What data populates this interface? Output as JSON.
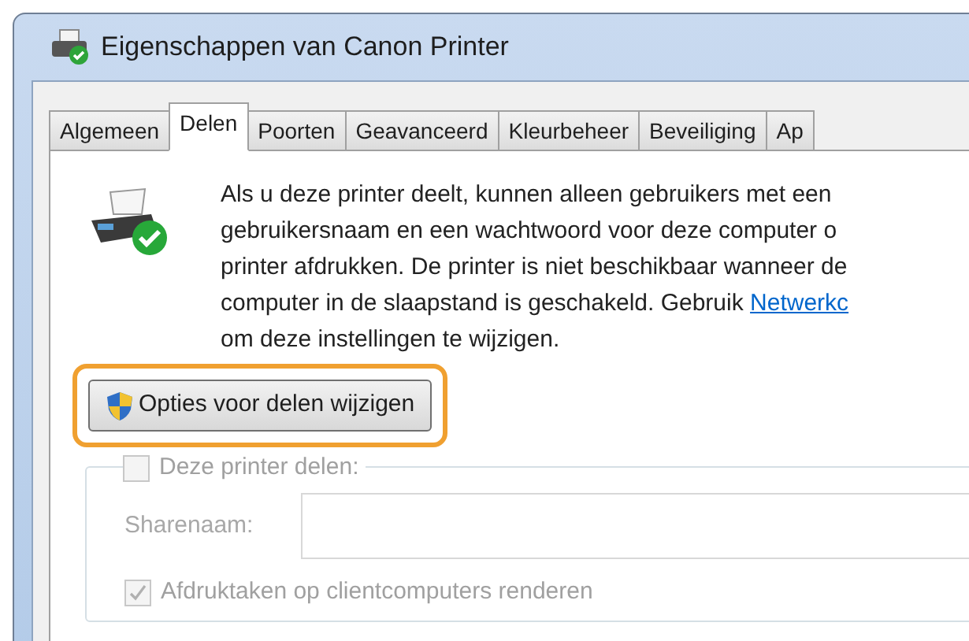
{
  "window": {
    "title": "Eigenschappen van Canon Printer"
  },
  "tabs": [
    {
      "label": "Algemeen",
      "selected": false
    },
    {
      "label": "Delen",
      "selected": true
    },
    {
      "label": "Poorten",
      "selected": false
    },
    {
      "label": "Geavanceerd",
      "selected": false
    },
    {
      "label": "Kleurbeheer",
      "selected": false
    },
    {
      "label": "Beveiliging",
      "selected": false
    },
    {
      "label": "Ap",
      "selected": false
    }
  ],
  "description": {
    "lines": [
      "Als u deze printer deelt, kunnen alleen gebruikers met een",
      "gebruikersnaam en een wachtwoord voor deze computer o",
      "printer afdrukken. De printer is niet beschikbaar wanneer de",
      "computer in de slaapstand is geschakeld. Gebruik "
    ],
    "link": "Netwerkc",
    "after": "om deze instellingen te wijzigen."
  },
  "change_button": {
    "label": "Opties voor delen wijzigen",
    "highlighted": true
  },
  "share_checkbox": {
    "label": "Deze printer delen:",
    "checked": false,
    "disabled": true
  },
  "share_name": {
    "label": "Sharenaam:",
    "disabled": true
  },
  "render_checkbox": {
    "label": "Afdruktaken op clientcomputers renderen",
    "checked": true,
    "disabled": true
  }
}
